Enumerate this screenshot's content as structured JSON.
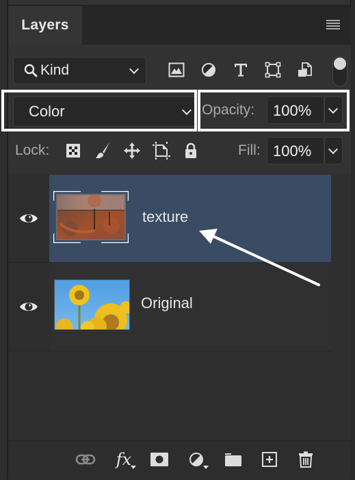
{
  "panel": {
    "tab_label": "Layers",
    "menu_icon": "hamburger-menu-icon"
  },
  "filter": {
    "kind_label": "Kind",
    "search_icon": "magnifier-icon",
    "icons": [
      "pixel-layer-filter-icon",
      "adjustment-layer-filter-icon",
      "type-layer-filter-icon",
      "shape-layer-filter-icon",
      "smart-object-filter-icon"
    ],
    "toggle_on": true
  },
  "blend": {
    "mode": "Color",
    "opacity_label": "Opacity:",
    "opacity_value": "100%",
    "lock_label": "Lock:",
    "lock_icons": [
      "lock-transparent-pixels-icon",
      "lock-image-pixels-icon",
      "lock-position-icon",
      "lock-artboard-icon",
      "lock-all-icon"
    ],
    "fill_label": "Fill:",
    "fill_value": "100%"
  },
  "layers": [
    {
      "name": "texture",
      "visible": true,
      "selected": true,
      "thumbnail": "rusty-metal-texture"
    },
    {
      "name": "Original",
      "visible": true,
      "selected": false,
      "thumbnail": "sunflowers-blue-sky"
    }
  ],
  "bottom_toolbar": [
    "link-layers-icon",
    "layer-style-fx-icon",
    "add-mask-icon",
    "new-adjustment-layer-icon",
    "new-group-folder-icon",
    "new-layer-icon",
    "delete-layer-trash-icon"
  ],
  "fx_label": "fx",
  "colors": {
    "selected_row": "#3a4c63",
    "panel_bg": "#323232",
    "highlight_box": "#ffffff"
  }
}
